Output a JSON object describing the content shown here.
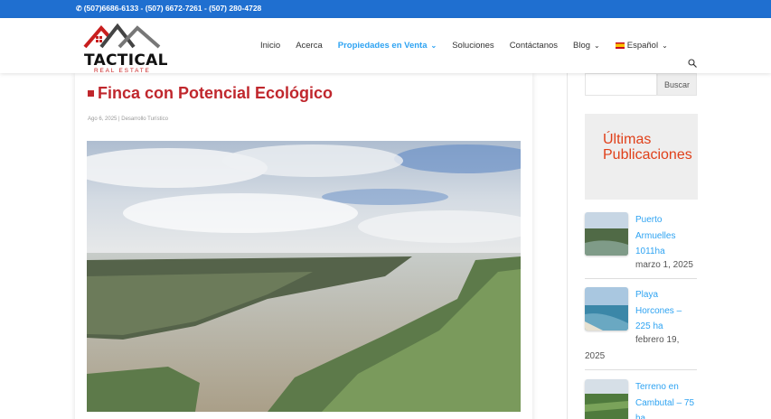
{
  "topbar": {
    "phones": "(507)6686-6133 - (507) 6672-7261 - (507) 280-4728"
  },
  "logo": {
    "name": "TACTICAL",
    "tagline": "REAL ESTATE"
  },
  "nav": {
    "items": [
      {
        "label": "Inicio"
      },
      {
        "label": "Acerca"
      },
      {
        "label": "Propiedades en Venta"
      },
      {
        "label": "Soluciones"
      },
      {
        "label": "Contáctanos"
      },
      {
        "label": "Blog"
      },
      {
        "label": "Español"
      }
    ]
  },
  "post": {
    "title": "Finca con Potencial Ecológico",
    "meta": "Ago 6, 2025 | Desarrollo Turístico"
  },
  "sidebar": {
    "search_button": "Buscar",
    "recent_title": "Últimas Publicaciones",
    "recent_posts": [
      {
        "line1": "Puerto",
        "line2": "Armuelles",
        "line3": "1011ha",
        "date": "marzo 1, 2025"
      },
      {
        "line1": "Playa",
        "line2": "Horcones –",
        "line3": "225 ha",
        "date_line1": "febrero 19,",
        "date_line2": "2025"
      },
      {
        "line1": "Terreno en",
        "line2": "Cambutal – 75",
        "line3": "ha"
      }
    ]
  },
  "colors": {
    "topbar": "#1f6fd0",
    "accent": "#c0272d",
    "link": "#2ea3f2",
    "recent_title": "#e0401a"
  }
}
